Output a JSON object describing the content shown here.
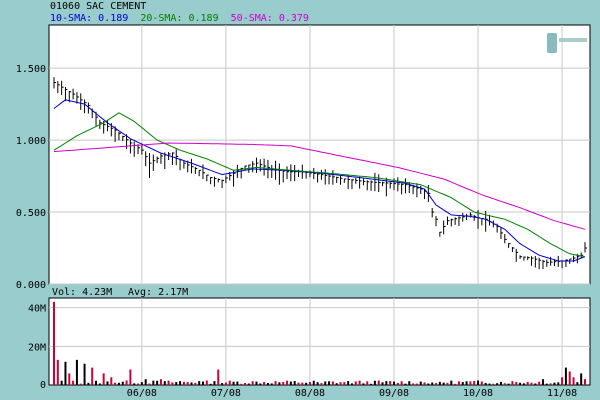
{
  "header": {
    "title": "01060 SAC CEMENT",
    "sma10_label": "10-SMA: 0.189",
    "sma20_label": "20-SMA: 0.189",
    "sma50_label": "50-SMA: 0.379"
  },
  "colors": {
    "background": "#99cccc",
    "plot_bg": "#ffffff",
    "grid": "#c8c8c8",
    "price_bars": "#000000",
    "sma10": "#0000cc",
    "sma20": "#008000",
    "sma50": "#cc00cc",
    "volume_up": "#000000",
    "volume_down": "#cc0033"
  },
  "logo_text": "",
  "chart_data": [
    {
      "type": "line",
      "title": "01060 SAC CEMENT",
      "ylim": [
        0,
        1.8
      ],
      "y_ticks": [
        "0.000",
        "0.500",
        "1.000",
        "1.500"
      ],
      "y_tick_values": [
        0,
        0.5,
        1.0,
        1.5
      ],
      "x_ticks": [
        "06/08",
        "07/08",
        "08/08",
        "09/08",
        "10/08",
        "11/08"
      ],
      "x_tick_index": [
        23,
        45,
        67,
        89,
        111,
        133
      ],
      "n": 140,
      "price_anchors": [
        [
          0,
          1.4
        ],
        [
          5,
          1.32
        ],
        [
          9,
          1.24
        ],
        [
          12,
          1.12
        ],
        [
          16,
          1.07
        ],
        [
          20,
          0.98
        ],
        [
          23,
          0.93
        ],
        [
          25,
          0.84
        ],
        [
          28,
          0.89
        ],
        [
          31,
          0.91
        ],
        [
          34,
          0.84
        ],
        [
          38,
          0.79
        ],
        [
          41,
          0.74
        ],
        [
          44,
          0.72
        ],
        [
          47,
          0.77
        ],
        [
          50,
          0.82
        ],
        [
          53,
          0.84
        ],
        [
          57,
          0.8
        ],
        [
          61,
          0.78
        ],
        [
          65,
          0.78
        ],
        [
          70,
          0.76
        ],
        [
          76,
          0.73
        ],
        [
          82,
          0.71
        ],
        [
          88,
          0.7
        ],
        [
          92,
          0.69
        ],
        [
          96,
          0.66
        ],
        [
          98,
          0.63
        ],
        [
          99,
          0.5
        ],
        [
          100,
          0.45
        ],
        [
          101,
          0.36
        ],
        [
          103,
          0.44
        ],
        [
          106,
          0.46
        ],
        [
          109,
          0.48
        ],
        [
          111,
          0.46
        ],
        [
          113,
          0.45
        ],
        [
          116,
          0.4
        ],
        [
          118,
          0.31
        ],
        [
          120,
          0.25
        ],
        [
          122,
          0.19
        ],
        [
          125,
          0.18
        ],
        [
          129,
          0.15
        ],
        [
          133,
          0.16
        ],
        [
          136,
          0.18
        ],
        [
          138,
          0.2
        ],
        [
          139,
          0.25
        ]
      ],
      "series": [
        {
          "name": "10-SMA",
          "anchors": [
            [
              0,
              1.22
            ],
            [
              3,
              1.28
            ],
            [
              8,
              1.25
            ],
            [
              14,
              1.12
            ],
            [
              20,
              1.01
            ],
            [
              28,
              0.91
            ],
            [
              36,
              0.84
            ],
            [
              44,
              0.76
            ],
            [
              52,
              0.8
            ],
            [
              60,
              0.79
            ],
            [
              70,
              0.77
            ],
            [
              80,
              0.74
            ],
            [
              92,
              0.7
            ],
            [
              97,
              0.66
            ],
            [
              100,
              0.55
            ],
            [
              104,
              0.48
            ],
            [
              109,
              0.47
            ],
            [
              113,
              0.45
            ],
            [
              118,
              0.38
            ],
            [
              122,
              0.28
            ],
            [
              127,
              0.2
            ],
            [
              132,
              0.16
            ],
            [
              136,
              0.16
            ],
            [
              139,
              0.19
            ]
          ]
        },
        {
          "name": "20-SMA",
          "anchors": [
            [
              0,
              0.93
            ],
            [
              6,
              1.03
            ],
            [
              13,
              1.12
            ],
            [
              17,
              1.19
            ],
            [
              21,
              1.13
            ],
            [
              27,
              1.0
            ],
            [
              33,
              0.93
            ],
            [
              40,
              0.87
            ],
            [
              47,
              0.79
            ],
            [
              53,
              0.81
            ],
            [
              62,
              0.79
            ],
            [
              72,
              0.77
            ],
            [
              84,
              0.74
            ],
            [
              96,
              0.69
            ],
            [
              104,
              0.6
            ],
            [
              110,
              0.5
            ],
            [
              118,
              0.45
            ],
            [
              124,
              0.38
            ],
            [
              130,
              0.28
            ],
            [
              135,
              0.21
            ],
            [
              139,
              0.19
            ]
          ]
        },
        {
          "name": "50-SMA",
          "anchors": [
            [
              0,
              0.92
            ],
            [
              15,
              0.95
            ],
            [
              30,
              0.98
            ],
            [
              52,
              0.97
            ],
            [
              62,
              0.96
            ],
            [
              75,
              0.89
            ],
            [
              90,
              0.81
            ],
            [
              102,
              0.73
            ],
            [
              112,
              0.62
            ],
            [
              122,
              0.53
            ],
            [
              131,
              0.44
            ],
            [
              139,
              0.38
            ]
          ]
        }
      ]
    },
    {
      "type": "bar",
      "title": "",
      "label": "Vol: 4.23M",
      "avg_label": "Avg: 2.17M",
      "ylim": [
        0,
        45
      ],
      "y_unit": "M",
      "y_ticks": [
        "20M",
        "40M"
      ],
      "y_tick_values": [
        20,
        40
      ],
      "volume_anchors": [
        [
          0,
          43
        ],
        [
          1,
          13
        ],
        [
          3,
          12
        ],
        [
          4,
          6
        ],
        [
          6,
          13
        ],
        [
          8,
          11
        ],
        [
          10,
          9
        ],
        [
          13,
          6
        ],
        [
          15,
          4
        ],
        [
          20,
          8
        ],
        [
          24,
          3
        ],
        [
          28,
          3
        ],
        [
          33,
          2
        ],
        [
          38,
          2
        ],
        [
          42,
          2
        ],
        [
          43,
          8
        ],
        [
          44,
          1
        ],
        [
          70,
          1
        ],
        [
          100,
          1
        ],
        [
          120,
          2
        ],
        [
          128,
          3
        ],
        [
          133,
          4
        ],
        [
          134,
          9
        ],
        [
          135,
          7
        ],
        [
          136,
          4
        ],
        [
          138,
          6
        ],
        [
          139,
          3
        ]
      ],
      "volume_baseline": 1.5
    }
  ]
}
